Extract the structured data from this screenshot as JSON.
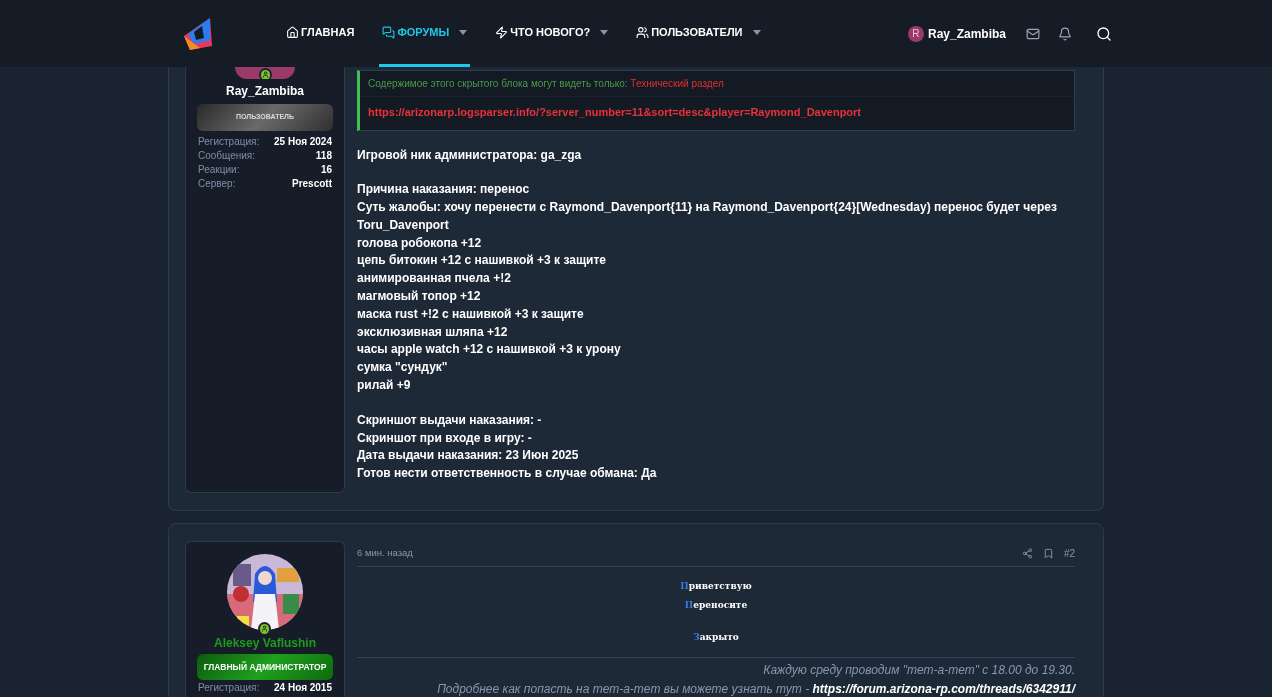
{
  "nav": {
    "items": [
      {
        "label": "ГЛАВНАЯ",
        "dropdown": false,
        "selected": false
      },
      {
        "label": "ФОРУМЫ",
        "dropdown": true,
        "selected": true
      },
      {
        "label": "ЧТО НОВОГО?",
        "dropdown": true,
        "selected": false
      },
      {
        "label": "ПОЛЬЗОВАТЕЛИ",
        "dropdown": true,
        "selected": false
      }
    ],
    "user": {
      "initial": "R",
      "name": "Ray_Zambiba"
    }
  },
  "posts": [
    {
      "author": {
        "name": "Ray_Zambiba",
        "kind": "user",
        "banner": "ПОЛЬЗОВАТЕЛЬ",
        "stats": [
          {
            "label": "Регистрация:",
            "value": "25 Ноя 2024"
          },
          {
            "label": "Сообщения:",
            "value": "118"
          },
          {
            "label": "Реакции:",
            "value": "16"
          },
          {
            "label": "Сервер:",
            "value": "Prescott"
          }
        ]
      },
      "hidden_block": {
        "notice": "Содержимое этого скрытого блока могут видеть только:",
        "group": "Технический раздел",
        "link": "https://arizonarp.logsparser.info/?server_number=11&sort=desc&player=Raymond_Davenport"
      },
      "paragraphs": [
        [
          "Игровой ник администратора: ga_zga"
        ],
        [
          "Причина наказания: перенос",
          "Суть жалобы: хочу перенести с Raymond_Davenport{11} на Raymond_Davenport{24}[Wednesday) перенос будет через Toru_Davenport",
          "голова робокопа +12",
          "цепь битокин +12 с нашивкой +3 к защите",
          "анимированная пчела +!2",
          "магмовый топор +12",
          "маска rust +!2 с нашивкой +3 к защите",
          "эксклюзивная шляпа +12",
          "часы apple watch +12 с нашивкой +3 к урону",
          "сумка \"сундук\"",
          "рилай +9"
        ],
        [
          "Скриншот выдачи наказания: -",
          "Скриншот при входе в игру: -",
          "Дата выдачи наказания: 23 Июн 2025",
          "Готов нести ответственность в случае обмана: Да"
        ]
      ]
    },
    {
      "author": {
        "name": "Aleksey Vaflushin",
        "kind": "admin",
        "banner": "ГЛАВНЫЙ АДМИНИСТРАТОР",
        "stats": [
          {
            "label": "Регистрация:",
            "value": "24 Ноя 2015"
          }
        ]
      },
      "time": "6 мин. назад",
      "number": "#2",
      "greeting": [
        {
          "initial": "П",
          "rest": "риветствую"
        },
        {
          "initial": "П",
          "rest": "ереносите"
        },
        {
          "initial": "З",
          "rest": "акрыто"
        }
      ],
      "signature": {
        "line1": "Каждую среду проводим \"тет-а-тет\" с 18.00 до 19.30.",
        "line2": "Подробнее как попасть на тет-а-тет вы можете узнать тут -",
        "link": "https://forum.arizona-rp.com/threads/6342911/"
      }
    }
  ]
}
